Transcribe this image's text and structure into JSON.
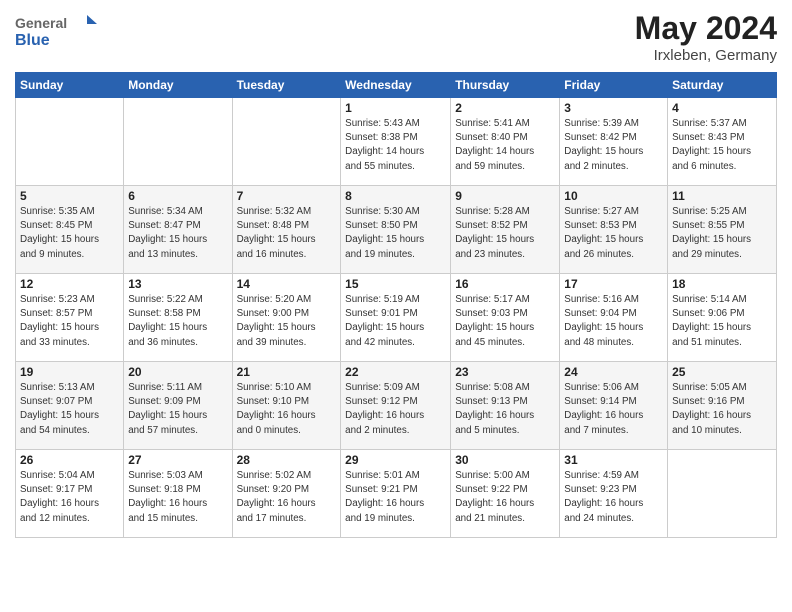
{
  "header": {
    "logo_general": "General",
    "logo_blue": "Blue",
    "month_title": "May 2024",
    "location": "Irxleben, Germany"
  },
  "days_of_week": [
    "Sunday",
    "Monday",
    "Tuesday",
    "Wednesday",
    "Thursday",
    "Friday",
    "Saturday"
  ],
  "weeks": [
    [
      {
        "day": "",
        "info": ""
      },
      {
        "day": "",
        "info": ""
      },
      {
        "day": "",
        "info": ""
      },
      {
        "day": "1",
        "info": "Sunrise: 5:43 AM\nSunset: 8:38 PM\nDaylight: 14 hours\nand 55 minutes."
      },
      {
        "day": "2",
        "info": "Sunrise: 5:41 AM\nSunset: 8:40 PM\nDaylight: 14 hours\nand 59 minutes."
      },
      {
        "day": "3",
        "info": "Sunrise: 5:39 AM\nSunset: 8:42 PM\nDaylight: 15 hours\nand 2 minutes."
      },
      {
        "day": "4",
        "info": "Sunrise: 5:37 AM\nSunset: 8:43 PM\nDaylight: 15 hours\nand 6 minutes."
      }
    ],
    [
      {
        "day": "5",
        "info": "Sunrise: 5:35 AM\nSunset: 8:45 PM\nDaylight: 15 hours\nand 9 minutes."
      },
      {
        "day": "6",
        "info": "Sunrise: 5:34 AM\nSunset: 8:47 PM\nDaylight: 15 hours\nand 13 minutes."
      },
      {
        "day": "7",
        "info": "Sunrise: 5:32 AM\nSunset: 8:48 PM\nDaylight: 15 hours\nand 16 minutes."
      },
      {
        "day": "8",
        "info": "Sunrise: 5:30 AM\nSunset: 8:50 PM\nDaylight: 15 hours\nand 19 minutes."
      },
      {
        "day": "9",
        "info": "Sunrise: 5:28 AM\nSunset: 8:52 PM\nDaylight: 15 hours\nand 23 minutes."
      },
      {
        "day": "10",
        "info": "Sunrise: 5:27 AM\nSunset: 8:53 PM\nDaylight: 15 hours\nand 26 minutes."
      },
      {
        "day": "11",
        "info": "Sunrise: 5:25 AM\nSunset: 8:55 PM\nDaylight: 15 hours\nand 29 minutes."
      }
    ],
    [
      {
        "day": "12",
        "info": "Sunrise: 5:23 AM\nSunset: 8:57 PM\nDaylight: 15 hours\nand 33 minutes."
      },
      {
        "day": "13",
        "info": "Sunrise: 5:22 AM\nSunset: 8:58 PM\nDaylight: 15 hours\nand 36 minutes."
      },
      {
        "day": "14",
        "info": "Sunrise: 5:20 AM\nSunset: 9:00 PM\nDaylight: 15 hours\nand 39 minutes."
      },
      {
        "day": "15",
        "info": "Sunrise: 5:19 AM\nSunset: 9:01 PM\nDaylight: 15 hours\nand 42 minutes."
      },
      {
        "day": "16",
        "info": "Sunrise: 5:17 AM\nSunset: 9:03 PM\nDaylight: 15 hours\nand 45 minutes."
      },
      {
        "day": "17",
        "info": "Sunrise: 5:16 AM\nSunset: 9:04 PM\nDaylight: 15 hours\nand 48 minutes."
      },
      {
        "day": "18",
        "info": "Sunrise: 5:14 AM\nSunset: 9:06 PM\nDaylight: 15 hours\nand 51 minutes."
      }
    ],
    [
      {
        "day": "19",
        "info": "Sunrise: 5:13 AM\nSunset: 9:07 PM\nDaylight: 15 hours\nand 54 minutes."
      },
      {
        "day": "20",
        "info": "Sunrise: 5:11 AM\nSunset: 9:09 PM\nDaylight: 15 hours\nand 57 minutes."
      },
      {
        "day": "21",
        "info": "Sunrise: 5:10 AM\nSunset: 9:10 PM\nDaylight: 16 hours\nand 0 minutes."
      },
      {
        "day": "22",
        "info": "Sunrise: 5:09 AM\nSunset: 9:12 PM\nDaylight: 16 hours\nand 2 minutes."
      },
      {
        "day": "23",
        "info": "Sunrise: 5:08 AM\nSunset: 9:13 PM\nDaylight: 16 hours\nand 5 minutes."
      },
      {
        "day": "24",
        "info": "Sunrise: 5:06 AM\nSunset: 9:14 PM\nDaylight: 16 hours\nand 7 minutes."
      },
      {
        "day": "25",
        "info": "Sunrise: 5:05 AM\nSunset: 9:16 PM\nDaylight: 16 hours\nand 10 minutes."
      }
    ],
    [
      {
        "day": "26",
        "info": "Sunrise: 5:04 AM\nSunset: 9:17 PM\nDaylight: 16 hours\nand 12 minutes."
      },
      {
        "day": "27",
        "info": "Sunrise: 5:03 AM\nSunset: 9:18 PM\nDaylight: 16 hours\nand 15 minutes."
      },
      {
        "day": "28",
        "info": "Sunrise: 5:02 AM\nSunset: 9:20 PM\nDaylight: 16 hours\nand 17 minutes."
      },
      {
        "day": "29",
        "info": "Sunrise: 5:01 AM\nSunset: 9:21 PM\nDaylight: 16 hours\nand 19 minutes."
      },
      {
        "day": "30",
        "info": "Sunrise: 5:00 AM\nSunset: 9:22 PM\nDaylight: 16 hours\nand 21 minutes."
      },
      {
        "day": "31",
        "info": "Sunrise: 4:59 AM\nSunset: 9:23 PM\nDaylight: 16 hours\nand 24 minutes."
      },
      {
        "day": "",
        "info": ""
      }
    ]
  ]
}
